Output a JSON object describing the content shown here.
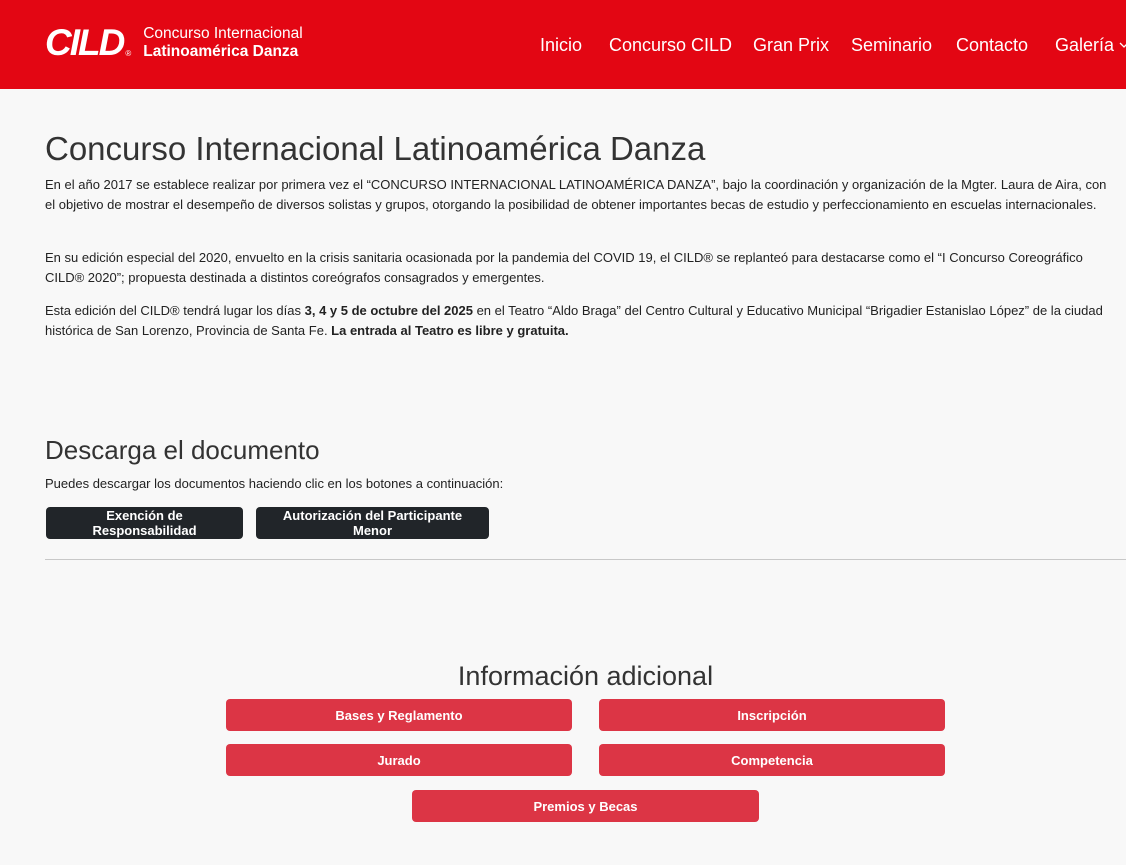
{
  "header": {
    "logo_mark": "CILD",
    "logo_reg": "®",
    "logo_line1": "Concurso Internacional",
    "logo_line2": "Latinoamérica Danza",
    "brand_color": "#e30613"
  },
  "nav": {
    "items": [
      {
        "label": "Inicio"
      },
      {
        "label": "Concurso CILD"
      },
      {
        "label": "Gran Prix"
      },
      {
        "label": "Seminario"
      },
      {
        "label": "Contacto"
      },
      {
        "label": "Galería"
      }
    ]
  },
  "main": {
    "title": "Concurso Internacional Latinoamérica Danza",
    "p1": "En el año 2017 se establece realizar por primera vez el “CONCURSO INTERNACIONAL LATINOAMÉRICA DANZA”, bajo la coordinación y organización de la Mgter. Laura de Aira, con el objetivo de mostrar el desempeño de diversos solistas y grupos, otorgando la posibilidad de obtener importantes becas de estudio y perfeccionamiento en escuelas internacionales.",
    "p2": "En su edición especial del 2020, envuelto en la crisis sanitaria ocasionada por la pandemia del COVID 19, el CILD® se replanteó para destacarse como el “I Concurso Coreográfico CILD® 2020”; propuesta destinada a distintos coreógrafos consagrados y emergentes.",
    "p3_a": "Esta edición del CILD® tendrá lugar los días ",
    "p3_b": "3, 4 y 5 de octubre del 2025",
    "p3_c": " en el Teatro “Aldo Braga” del Centro Cultural y Educativo Municipal “Brigadier Estanislao López” de la ciudad histórica de San Lorenzo, Provincia de Santa Fe. ",
    "p3_d": "La entrada al Teatro es libre y gratuita."
  },
  "download": {
    "title": "Descarga el documento",
    "subtitle": "Puedes descargar los documentos haciendo clic en los botones a continuación:",
    "btn1": "Exención de Responsabilidad",
    "btn2": "Autorización del Participante Menor"
  },
  "info": {
    "title": "Información adicional",
    "buttons": [
      {
        "label": "Bases y Reglamento"
      },
      {
        "label": "Inscripción"
      },
      {
        "label": "Jurado"
      },
      {
        "label": "Competencia"
      },
      {
        "label": "Premios y Becas"
      }
    ],
    "button_color": "#dc3545"
  }
}
